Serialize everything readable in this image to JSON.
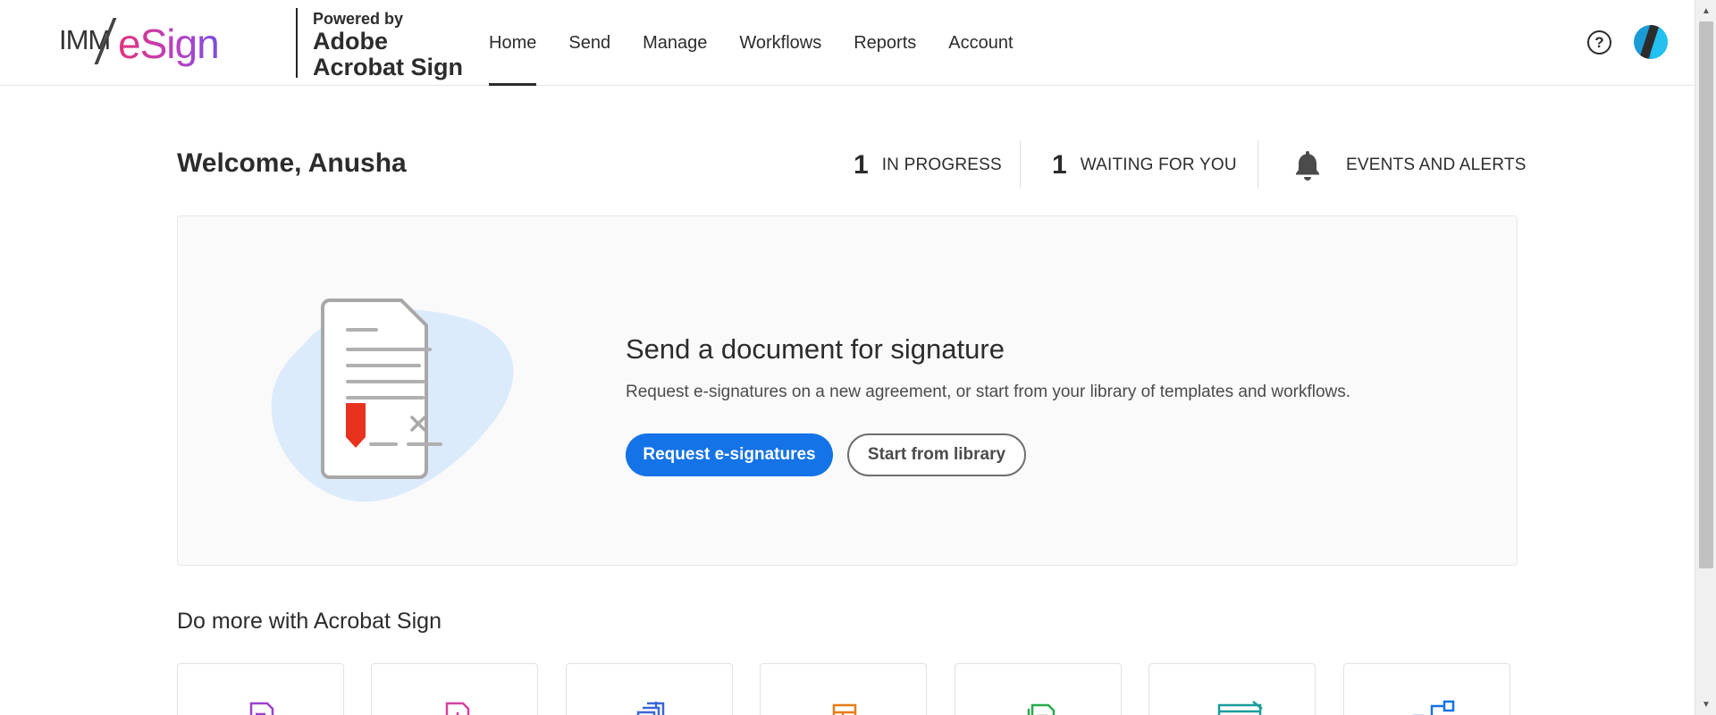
{
  "header": {
    "logo": {
      "imm": "IMM",
      "esign": "eSign"
    },
    "powered_by": {
      "line1": "Powered by",
      "line2": "Adobe",
      "line3": "Acrobat Sign"
    },
    "nav": [
      {
        "label": "Home",
        "active": true
      },
      {
        "label": "Send",
        "active": false
      },
      {
        "label": "Manage",
        "active": false
      },
      {
        "label": "Workflows",
        "active": false
      },
      {
        "label": "Reports",
        "active": false
      },
      {
        "label": "Account",
        "active": false
      }
    ],
    "help_symbol": "?"
  },
  "welcome": {
    "text": "Welcome, Anusha"
  },
  "stats": {
    "in_progress": {
      "count": "1",
      "label": "IN PROGRESS"
    },
    "waiting": {
      "count": "1",
      "label": "WAITING FOR YOU"
    },
    "events": {
      "label": "EVENTS AND ALERTS"
    }
  },
  "hero": {
    "title": "Send a document for signature",
    "subtitle": "Request e-signatures on a new agreement, or start from your library of templates and workflows.",
    "primary_button": "Request e-signatures",
    "secondary_button": "Start from library"
  },
  "do_more": {
    "title": "Do more with Acrobat Sign",
    "tiles": [
      {
        "icon": "fill-sign-icon",
        "color": "#9d3fd1"
      },
      {
        "icon": "publish-web-form-icon",
        "color": "#d6409f"
      },
      {
        "icon": "bulk-send-icon",
        "color": "#3a67d6"
      },
      {
        "icon": "template-icon",
        "color": "#e87c16"
      },
      {
        "icon": "document-icon",
        "color": "#2aa84a"
      },
      {
        "icon": "web-form-icon",
        "color": "#1a9c9c"
      },
      {
        "icon": "workflow-icon",
        "color": "#1473e6"
      }
    ]
  },
  "colors": {
    "accent": "#1473e6",
    "signature_flag": "#e8321e",
    "blob": "#dcebfb"
  }
}
